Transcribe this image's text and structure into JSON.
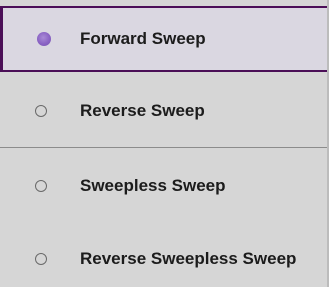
{
  "sweep_options": {
    "items": [
      {
        "label": "Forward Sweep",
        "selected": true
      },
      {
        "label": "Reverse Sweep",
        "selected": false
      },
      {
        "label": "Sweepless Sweep",
        "selected": false
      },
      {
        "label": "Reverse Sweepless Sweep",
        "selected": false
      }
    ]
  },
  "colors": {
    "selected_border": "#4b0f57",
    "selected_radio": "#8a63c4",
    "panel_background": "#d6d6d6"
  }
}
